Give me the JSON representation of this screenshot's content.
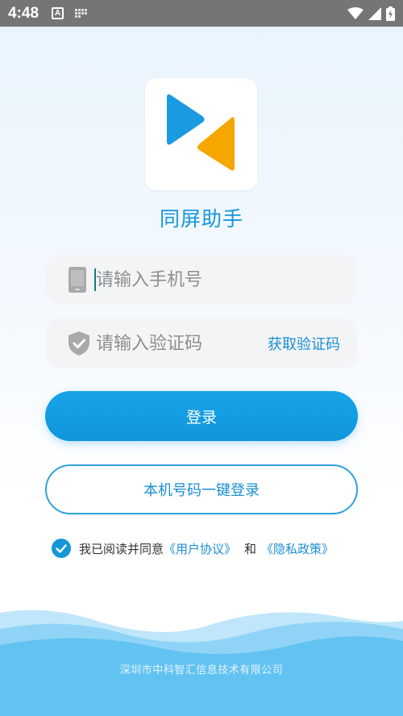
{
  "status_bar": {
    "time": "4:48",
    "a_label": "A"
  },
  "app": {
    "name": "同屏助手"
  },
  "phone_field": {
    "placeholder": "请输入手机号"
  },
  "code_field": {
    "placeholder": "请输入验证码",
    "get_code_label": "获取验证码"
  },
  "buttons": {
    "login_label": "登录",
    "one_click_label": "本机号码一键登录"
  },
  "agreement": {
    "checked": true,
    "prefix": "我已阅读并同意",
    "user_agreement": "《用户协议》",
    "and": "和",
    "privacy_policy": "《隐私政策》"
  },
  "footer": {
    "company": "深圳市中科智汇信息技术有限公司"
  },
  "colors": {
    "primary": "#1596d8",
    "logo_blue": "#1a9ae0",
    "logo_orange": "#f5a700",
    "status_bar": "#757575",
    "wave": "#5fc2f2"
  }
}
